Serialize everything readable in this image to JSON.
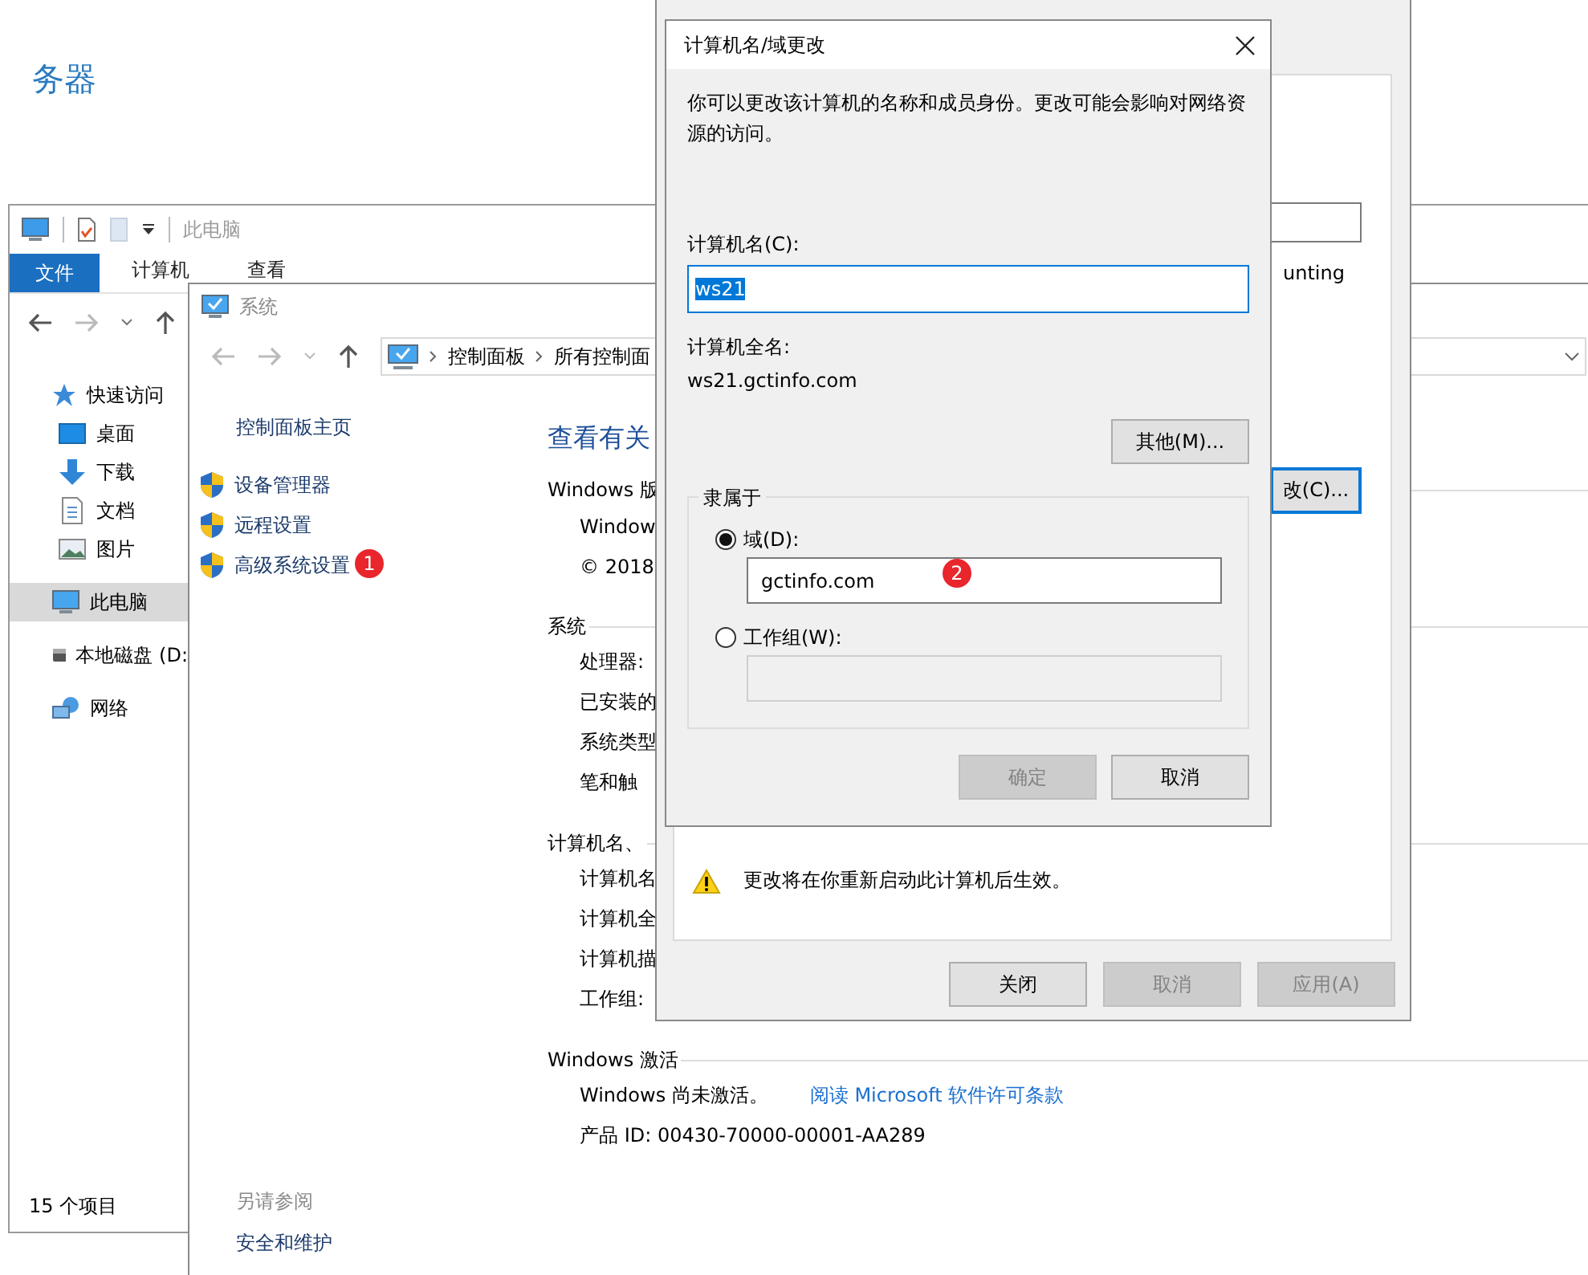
{
  "server_manager": {
    "heading": "务器"
  },
  "explorer": {
    "title": "此电脑",
    "ribbon_tabs": [
      {
        "label": "文件",
        "selected": true
      },
      {
        "label": "计算机",
        "selected": false
      },
      {
        "label": "查看",
        "selected": false
      }
    ],
    "sidebar": [
      {
        "label": "快速访问",
        "kind": "star",
        "selected": false,
        "children": [
          {
            "label": "桌面",
            "kind": "desktop",
            "selected": false
          },
          {
            "label": "下载",
            "kind": "download",
            "selected": false
          },
          {
            "label": "文档",
            "kind": "document",
            "selected": false
          },
          {
            "label": "图片",
            "kind": "image",
            "selected": false
          }
        ]
      },
      {
        "label": "此电脑",
        "kind": "computer",
        "selected": true
      },
      {
        "label": "本地磁盘 (D:",
        "kind": "drive",
        "selected": false
      },
      {
        "label": "网络",
        "kind": "network",
        "selected": false
      }
    ],
    "status": "15 个项目"
  },
  "control_panel": {
    "title": "系统",
    "breadcrumb": [
      "控制面板",
      "所有控制面"
    ],
    "home_link": "控制面板主页",
    "links": [
      {
        "label": "设备管理器"
      },
      {
        "label": "远程设置"
      },
      {
        "label": "高级系统设置",
        "badge": "1"
      }
    ],
    "see_also": {
      "heading": "另请参阅",
      "links": [
        "安全和维护"
      ]
    },
    "heading": "查看有关",
    "sections": [
      {
        "title": "Windows 版",
        "rows": [
          {
            "text": "Window"
          },
          {
            "text": "© 2018"
          }
        ]
      },
      {
        "title": "系统",
        "rows": [
          {
            "text": "处理器:"
          },
          {
            "text": "已安装的"
          },
          {
            "text": "系统类型"
          },
          {
            "text": "笔和触"
          }
        ]
      },
      {
        "title": "计算机名、",
        "rows": [
          {
            "text": "计算机名"
          },
          {
            "text": "计算机全"
          },
          {
            "text": "计算机描"
          },
          {
            "text": "工作组:"
          }
        ]
      },
      {
        "title": "Windows 激活",
        "rows": [
          {
            "text": "Windows 尚未激活。",
            "link": "阅读 Microsoft 软件许可条款"
          },
          {
            "text": "产品 ID: 00430-70000-00001-AA289"
          }
        ]
      }
    ]
  },
  "system_properties": {
    "text_fragment": "unting",
    "change_button": {
      "label": "改(C)...",
      "focused": true
    },
    "warning": "更改将在你重新启动此计算机后生效。",
    "buttons": [
      {
        "label": "关闭",
        "disabled": false
      },
      {
        "label": "取消",
        "disabled": true
      },
      {
        "label": "应用(A)",
        "disabled": true
      }
    ]
  },
  "dialog": {
    "title": "计算机名/域更改",
    "description": "你可以更改该计算机的名称和成员身份。更改可能会影响对网络资源的访问。",
    "computer_name": {
      "label": "计算机名(C):",
      "value": "ws21",
      "selected": true
    },
    "full_name": {
      "label": "计算机全名:",
      "value": "ws21.gctinfo.com"
    },
    "more_button": "其他(M)...",
    "member_of": {
      "legend": "隶属于",
      "options": [
        {
          "label": "域(D):",
          "selected": true,
          "value": "gctinfo.com",
          "badge": "2"
        },
        {
          "label": "工作组(W):",
          "selected": false
        }
      ]
    },
    "buttons": [
      {
        "label": "确定",
        "disabled": true
      },
      {
        "label": "取消",
        "disabled": false
      }
    ]
  }
}
